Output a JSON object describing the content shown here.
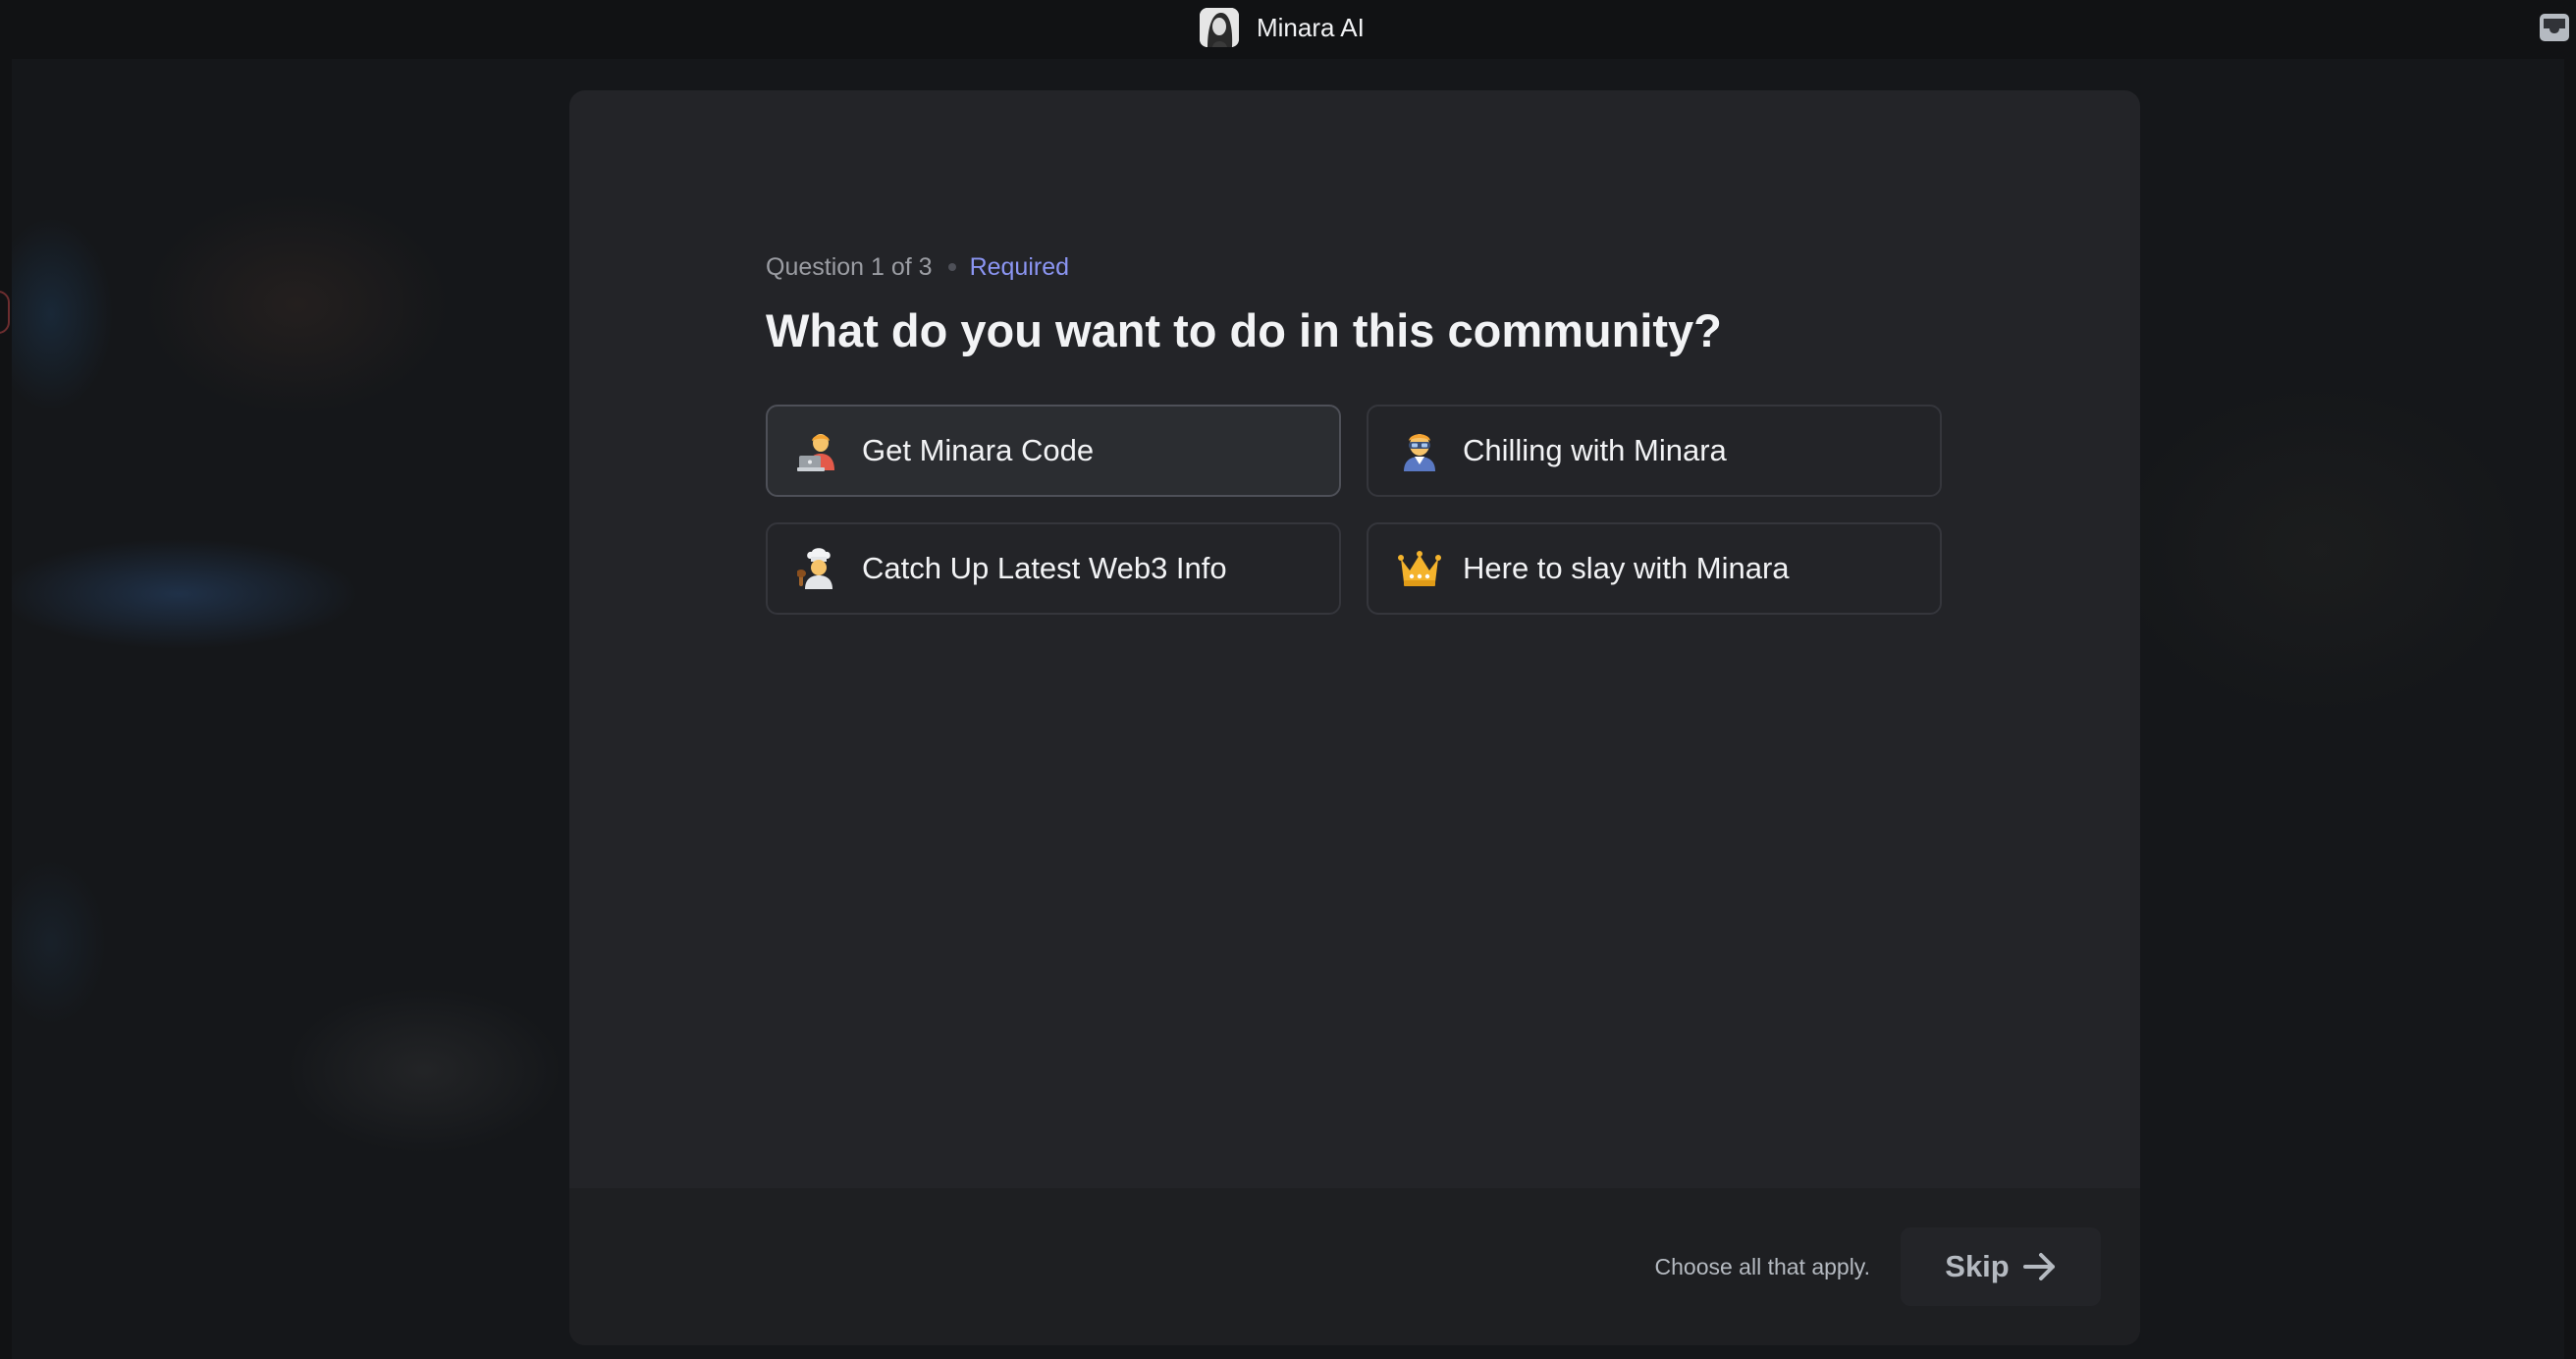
{
  "server": {
    "name": "Minara AI",
    "avatar_icon": "server-avatar-portrait"
  },
  "topbar": {
    "inbox_icon": "inbox-icon"
  },
  "question": {
    "counter": "Question 1 of 3",
    "required_label": "Required",
    "title": "What do you want to do in this community?",
    "options": [
      {
        "label": "Get Minara Code",
        "emoji": "technologist-emoji",
        "hovered": true
      },
      {
        "label": "Chilling with Minara",
        "emoji": "ninja-emoji",
        "hovered": false
      },
      {
        "label": "Catch Up Latest Web3 Info",
        "emoji": "cook-emoji",
        "hovered": false
      },
      {
        "label": "Here to slay with Minara",
        "emoji": "crown-emoji",
        "hovered": false
      }
    ]
  },
  "footer": {
    "hint": "Choose all that apply.",
    "skip_label": "Skip",
    "skip_icon": "arrow-right-icon"
  },
  "colors": {
    "background": "#111214",
    "modal": "#232428",
    "footer": "#1e1f22",
    "accent": "#8b95f2",
    "text": "#f2f3f5",
    "muted": "#b5bac1"
  }
}
